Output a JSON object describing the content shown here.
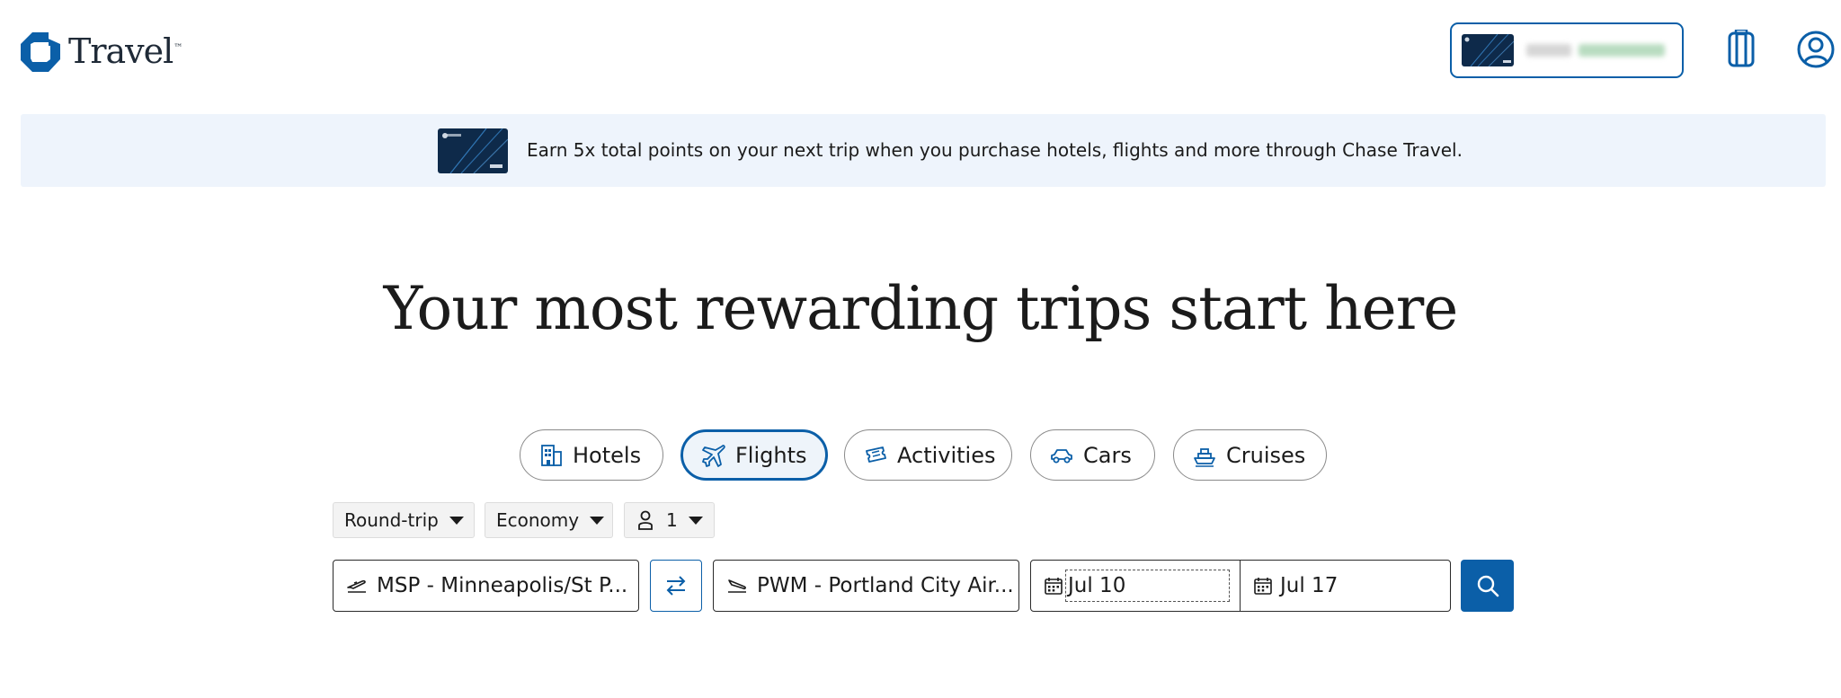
{
  "header": {
    "logo_text": "Travel",
    "logo_tm": "™"
  },
  "banner": {
    "text": "Earn 5x total points on your next trip when you purchase hotels, flights and more through Chase Travel."
  },
  "headline": "Your most rewarding trips start here",
  "tabs": [
    {
      "label": "Hotels",
      "icon": "hotel-icon",
      "active": false
    },
    {
      "label": "Flights",
      "icon": "plane-icon",
      "active": true
    },
    {
      "label": "Activities",
      "icon": "ticket-icon",
      "active": false
    },
    {
      "label": "Cars",
      "icon": "car-icon",
      "active": false
    },
    {
      "label": "Cruises",
      "icon": "ship-icon",
      "active": false
    }
  ],
  "options": {
    "trip_type": "Round-trip",
    "cabin": "Economy",
    "travelers": "1"
  },
  "search": {
    "origin": "MSP - Minneapolis/St P...",
    "destination": "PWM - Portland City Air...",
    "depart": "Jul 10",
    "return": "Jul 17"
  },
  "colors": {
    "brand_blue": "#0b5fa8",
    "banner_bg": "#eef4fc"
  }
}
